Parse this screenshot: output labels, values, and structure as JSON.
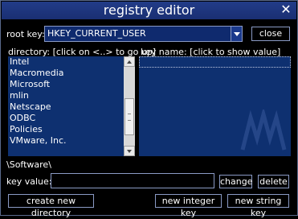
{
  "window": {
    "title": "registry editor",
    "close_glyph": "✕"
  },
  "rootkey": {
    "label": "root key:",
    "value": "HKEY_CURRENT_USER",
    "close_label": "close"
  },
  "directory": {
    "header": "directory: [click on <..> to go up]",
    "items": [
      "Intel",
      "Macromedia",
      "Microsoft",
      "mlin",
      "Netscape",
      "ODBC",
      "Policies",
      "VMware, Inc."
    ]
  },
  "keys": {
    "header": "key name: [click to show value]"
  },
  "path": "\\Software\\",
  "keyvalue": {
    "label": "key value:",
    "value": "",
    "change_label": "change",
    "delete_label": "delete"
  },
  "actions": {
    "create_dir_label": "create new directory",
    "new_int_label": "new integer key",
    "new_string_label": "new string key"
  },
  "colors": {
    "titlebar": "#1a2f73",
    "list_bg": "#0e3070",
    "border": "#8a9ac4",
    "background": "#000000"
  }
}
